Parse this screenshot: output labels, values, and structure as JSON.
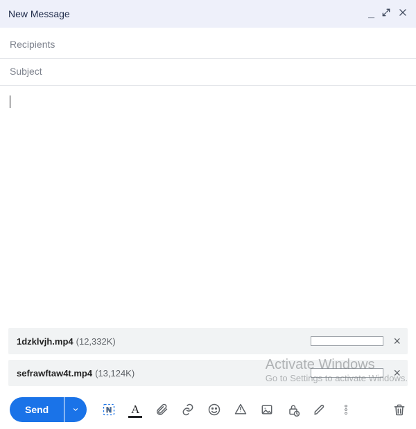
{
  "header": {
    "title": "New Message"
  },
  "fields": {
    "recipients_placeholder": "Recipients",
    "recipients_value": "",
    "subject_placeholder": "Subject",
    "subject_value": ""
  },
  "body": {
    "content": ""
  },
  "attachments": [
    {
      "name": "1dzklvjh.mp4",
      "size": "(12,332K)"
    },
    {
      "name": "sefrawftaw4t.mp4",
      "size": "(13,124K)"
    }
  ],
  "toolbar": {
    "send_label": "Send"
  },
  "watermark": {
    "line1": "Activate Windows",
    "line2": "Go to Settings to activate Windows."
  },
  "colors": {
    "accent": "#1a73e8",
    "header_bg": "#eef0fa",
    "chip_bg": "#f1f3f4",
    "icon": "#5f6368"
  }
}
